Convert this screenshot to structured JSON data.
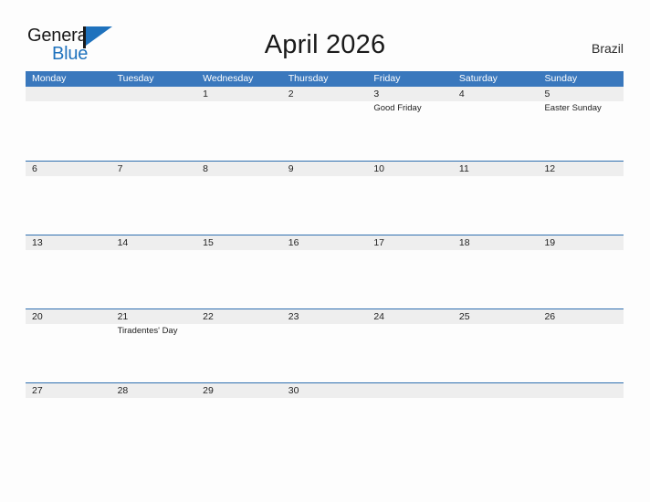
{
  "logo": {
    "word_top": "General",
    "word_bottom": "Blue",
    "accent_color": "#1f72bd",
    "icon": "flag-icon"
  },
  "header": {
    "title": "April 2026",
    "country": "Brazil"
  },
  "colors": {
    "header_blue": "#3a78bd",
    "row_rule": "#2f6fb0",
    "band_gray": "#eeeeee",
    "page_background": "#fdfdfd",
    "text": "#222222"
  },
  "calendar": {
    "weekday_headers": [
      "Monday",
      "Tuesday",
      "Wednesday",
      "Thursday",
      "Friday",
      "Saturday",
      "Sunday"
    ],
    "weeks": [
      [
        {
          "date": "",
          "holiday": ""
        },
        {
          "date": "",
          "holiday": ""
        },
        {
          "date": "1",
          "holiday": ""
        },
        {
          "date": "2",
          "holiday": ""
        },
        {
          "date": "3",
          "holiday": "Good Friday"
        },
        {
          "date": "4",
          "holiday": ""
        },
        {
          "date": "5",
          "holiday": "Easter Sunday"
        }
      ],
      [
        {
          "date": "6",
          "holiday": ""
        },
        {
          "date": "7",
          "holiday": ""
        },
        {
          "date": "8",
          "holiday": ""
        },
        {
          "date": "9",
          "holiday": ""
        },
        {
          "date": "10",
          "holiday": ""
        },
        {
          "date": "11",
          "holiday": ""
        },
        {
          "date": "12",
          "holiday": ""
        }
      ],
      [
        {
          "date": "13",
          "holiday": ""
        },
        {
          "date": "14",
          "holiday": ""
        },
        {
          "date": "15",
          "holiday": ""
        },
        {
          "date": "16",
          "holiday": ""
        },
        {
          "date": "17",
          "holiday": ""
        },
        {
          "date": "18",
          "holiday": ""
        },
        {
          "date": "19",
          "holiday": ""
        }
      ],
      [
        {
          "date": "20",
          "holiday": ""
        },
        {
          "date": "21",
          "holiday": "Tiradentes' Day"
        },
        {
          "date": "22",
          "holiday": ""
        },
        {
          "date": "23",
          "holiday": ""
        },
        {
          "date": "24",
          "holiday": ""
        },
        {
          "date": "25",
          "holiday": ""
        },
        {
          "date": "26",
          "holiday": ""
        }
      ],
      [
        {
          "date": "27",
          "holiday": ""
        },
        {
          "date": "28",
          "holiday": ""
        },
        {
          "date": "29",
          "holiday": ""
        },
        {
          "date": "30",
          "holiday": ""
        },
        {
          "date": "",
          "holiday": ""
        },
        {
          "date": "",
          "holiday": ""
        },
        {
          "date": "",
          "holiday": ""
        }
      ]
    ]
  }
}
